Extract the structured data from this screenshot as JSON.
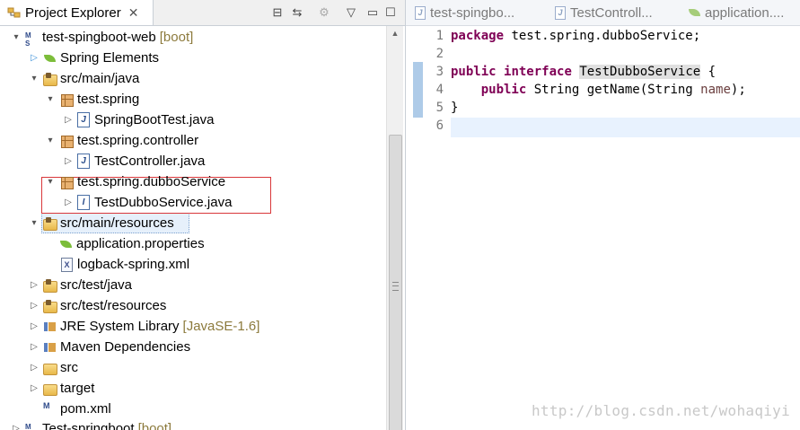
{
  "explorer": {
    "title": "Project Explorer",
    "close": "✕",
    "toolbar": {
      "collapse": "⊟",
      "link": "⇆",
      "filter": "⚙",
      "menu": "▽",
      "minimize": "▭",
      "maximize": "☐"
    },
    "items": [
      {
        "label": "test-spingboot-web",
        "deco": "[boot]",
        "icon": "maven-project-icon",
        "twisty": "▾"
      },
      {
        "label": "Spring Elements",
        "icon": "spring-leaf-icon",
        "twisty": "▷"
      },
      {
        "label": "src/main/java",
        "icon": "source-folder-icon",
        "twisty": "▾"
      },
      {
        "label": "test.spring",
        "icon": "package-icon",
        "twisty": "▾"
      },
      {
        "label": "SpringBootTest.java",
        "icon": "java-file-icon",
        "twisty": "▷"
      },
      {
        "label": "test.spring.controller",
        "icon": "package-icon",
        "twisty": "▾"
      },
      {
        "label": "TestController.java",
        "icon": "java-file-icon",
        "twisty": "▷"
      },
      {
        "label": "test.spring.dubboService",
        "icon": "package-icon",
        "twisty": "▾"
      },
      {
        "label": "TestDubboService.java",
        "icon": "java-interface-icon",
        "twisty": "▷"
      },
      {
        "label": "src/main/resources",
        "icon": "source-folder-icon",
        "twisty": "▾"
      },
      {
        "label": "application.properties",
        "icon": "spring-leaf-icon"
      },
      {
        "label": "logback-spring.xml",
        "icon": "xml-file-icon"
      },
      {
        "label": "src/test/java",
        "icon": "source-folder-icon",
        "twisty": "▷"
      },
      {
        "label": "src/test/resources",
        "icon": "source-folder-icon",
        "twisty": "▷"
      },
      {
        "label": "JRE System Library",
        "deco": "[JavaSE-1.6]",
        "icon": "library-icon",
        "twisty": "▷"
      },
      {
        "label": "Maven Dependencies",
        "icon": "library-icon",
        "twisty": "▷"
      },
      {
        "label": "src",
        "icon": "folder-icon",
        "twisty": "▷"
      },
      {
        "label": "target",
        "icon": "folder-icon",
        "twisty": "▷"
      },
      {
        "label": "pom.xml",
        "icon": "maven-file-icon"
      },
      {
        "label": "Test-springboot",
        "deco": "[boot]",
        "icon": "maven-project-icon",
        "twisty": "▷"
      }
    ]
  },
  "editor": {
    "tabs": [
      {
        "label": "test-spingbo...",
        "icon": "java-file-icon"
      },
      {
        "label": "TestControll...",
        "icon": "java-file-icon"
      },
      {
        "label": "application....",
        "icon": "spring-leaf-icon"
      }
    ],
    "line_numbers": [
      "1",
      "2",
      "3",
      "4",
      "5",
      "6"
    ],
    "code": {
      "l1_kw": "package",
      "l1_rest": " test.spring.dubboService;",
      "l3_kw1": "public",
      "l3_kw2": "interface",
      "l3_name": "TestDubboService",
      "l3_rest": " {",
      "l4_indent": "    ",
      "l4_kw": "public",
      "l4_mid": " String getName(String ",
      "l4_param": "name",
      "l4_end": ");",
      "l5": "}"
    }
  },
  "watermark": "http://blog.csdn.net/wohaqiyi",
  "scrollbar": {
    "up": "▲",
    "down": "▼"
  }
}
